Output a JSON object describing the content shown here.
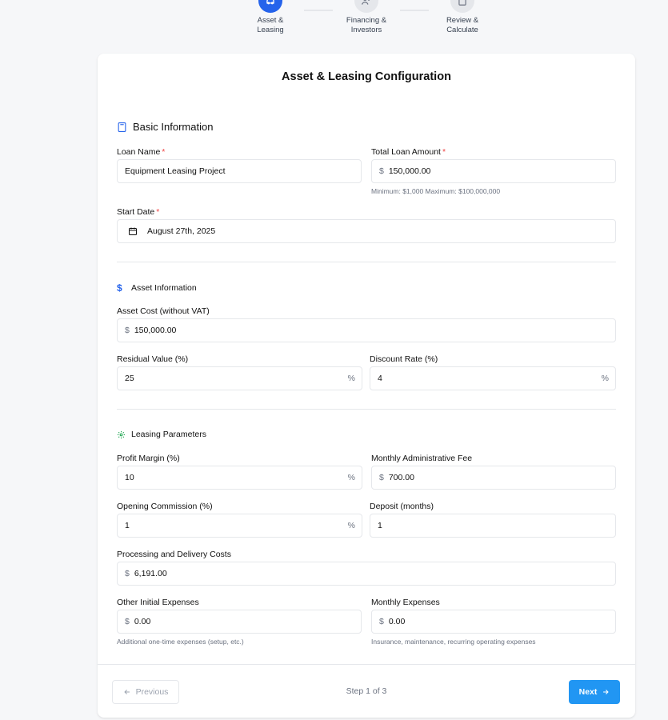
{
  "stepper": {
    "steps": [
      {
        "label": "Asset &\nLeasing",
        "state": "active"
      },
      {
        "label": "Financing &\nInvestors",
        "state": "inactive"
      },
      {
        "label": "Review &\nCalculate",
        "state": "inactive"
      }
    ]
  },
  "card": {
    "title": "Asset & Leasing Configuration"
  },
  "basic": {
    "heading": "Basic Information",
    "icon": "calculator-icon",
    "loan_name_label": "Loan Name",
    "loan_name_value": "Equipment Leasing Project",
    "total_loan_label": "Total Loan Amount",
    "total_loan_prefix": "$",
    "total_loan_value": "150,000.00",
    "total_loan_hint": "Minimum: $1,000 Maximum: $100,000,000",
    "start_date_label": "Start Date",
    "start_date_value": "August 27th, 2025",
    "required_mark": "*"
  },
  "asset": {
    "heading": "Asset Information",
    "icon": "dollar-icon",
    "cost_label": "Asset Cost (without VAT)",
    "cost_prefix": "$",
    "cost_value": "150,000.00",
    "residual_label": "Residual Value (%)",
    "residual_value": "25",
    "discount_label": "Discount Rate (%)",
    "discount_value": "4",
    "percent_suffix": "%"
  },
  "leasing": {
    "heading": "Leasing Parameters",
    "icon": "gear-icon",
    "profit_label": "Profit Margin (%)",
    "profit_value": "10",
    "admin_fee_label": "Monthly Administrative Fee",
    "admin_fee_value": "700.00",
    "opening_label": "Opening Commission (%)",
    "opening_value": "1",
    "deposit_label": "Deposit (months)",
    "deposit_value": "1",
    "processing_label": "Processing and Delivery Costs",
    "processing_value": "6,191.00",
    "other_initial_label": "Other Initial Expenses",
    "other_initial_value": "0.00",
    "other_initial_hint": "Additional one-time expenses (setup, etc.)",
    "monthly_exp_label": "Monthly Expenses",
    "monthly_exp_value": "0.00",
    "monthly_exp_hint": "Insurance, maintenance, recurring operating expenses",
    "currency_prefix": "$",
    "percent_suffix": "%"
  },
  "footer": {
    "previous_label": "Previous",
    "step_text": "Step 1 of 3",
    "next_label": "Next"
  },
  "colors": {
    "primary": "#2563eb",
    "next_button": "#2196f3",
    "required": "#ef4444",
    "gear": "#16a34a"
  }
}
